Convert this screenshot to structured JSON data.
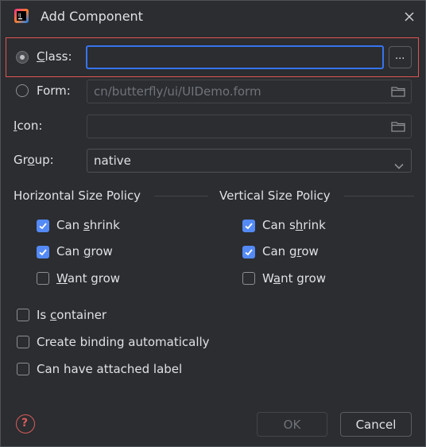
{
  "window": {
    "title": "Add Component"
  },
  "class_row": {
    "label_pre": "",
    "label_u": "C",
    "label_post": "lass:",
    "value": "",
    "browse_label": "..."
  },
  "form_row": {
    "label": "Form:",
    "value": "cn/butterfly/ui/UIDemo.form"
  },
  "icon_row": {
    "label_u": "I",
    "label_post": "con:",
    "value": ""
  },
  "group_row": {
    "label_pre": "Gr",
    "label_u": "o",
    "label_post": "up:",
    "value": "native"
  },
  "horizontal": {
    "title": "Horizontal Size Policy",
    "items": [
      {
        "pre": "Can ",
        "u": "s",
        "post": "hrink",
        "checked": true
      },
      {
        "pre": "Can ",
        "u": "g",
        "post": "row",
        "checked": true
      },
      {
        "pre": "",
        "u": "W",
        "post": "ant grow",
        "checked": false
      }
    ]
  },
  "vertical": {
    "title": "Vertical Size Policy",
    "items": [
      {
        "pre": "Can s",
        "u": "h",
        "post": "rink",
        "checked": true
      },
      {
        "pre": "Can g",
        "u": "r",
        "post": "ow",
        "checked": true
      },
      {
        "pre": "W",
        "u": "a",
        "post": "nt grow",
        "checked": false
      }
    ]
  },
  "options": [
    {
      "pre": "Is ",
      "u": "c",
      "post": "ontainer",
      "checked": false
    },
    {
      "pre": "Create binding automatically",
      "u": "",
      "post": "",
      "checked": false
    },
    {
      "pre": "Can have attached label",
      "u": "",
      "post": "",
      "checked": false
    }
  ],
  "footer": {
    "help": "?",
    "ok": "OK",
    "cancel": "Cancel"
  },
  "colors": {
    "accent": "#3574f0",
    "checkbox": "#548af7",
    "highlight": "#e05555",
    "help": "#db5c5c"
  }
}
